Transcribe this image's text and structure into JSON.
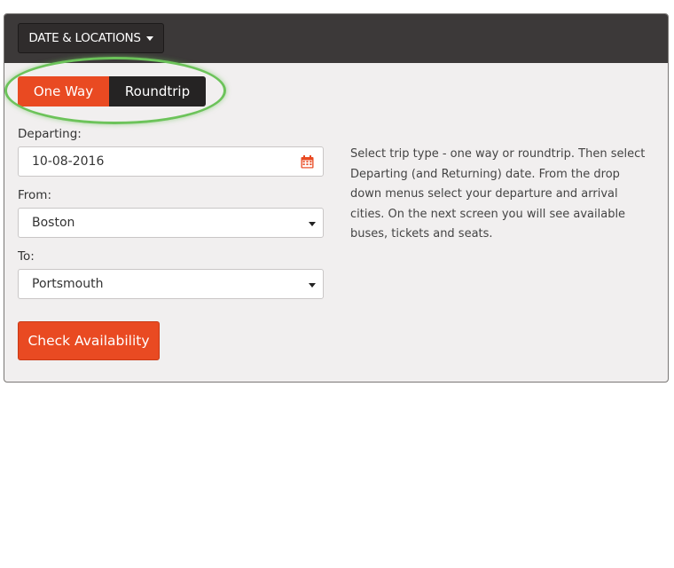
{
  "header": {
    "menu_label": "DATE & LOCATIONS"
  },
  "trip_type": {
    "options": [
      "One Way",
      "Roundtrip"
    ],
    "selected": "One Way"
  },
  "form": {
    "departing_label": "Departing:",
    "departing_value": "10-08-2016",
    "from_label": "From:",
    "from_value": "Boston",
    "to_label": "To:",
    "to_value": "Portsmouth",
    "submit_label": "Check Availability"
  },
  "help_text": "Select trip type - one way or roundtrip. Then select Departing (and Returning) date. From the drop down menus select your departure and arrival cities. On the next screen you will see available buses, tickets and seats.",
  "icons": {
    "date_picker": "calendar-icon",
    "dropdown": "chevron-down-icon"
  },
  "colors": {
    "accent": "#e94a22",
    "header": "#3c3939",
    "panel_bg": "#f1efef",
    "highlight_ring": "#6cc35a"
  }
}
